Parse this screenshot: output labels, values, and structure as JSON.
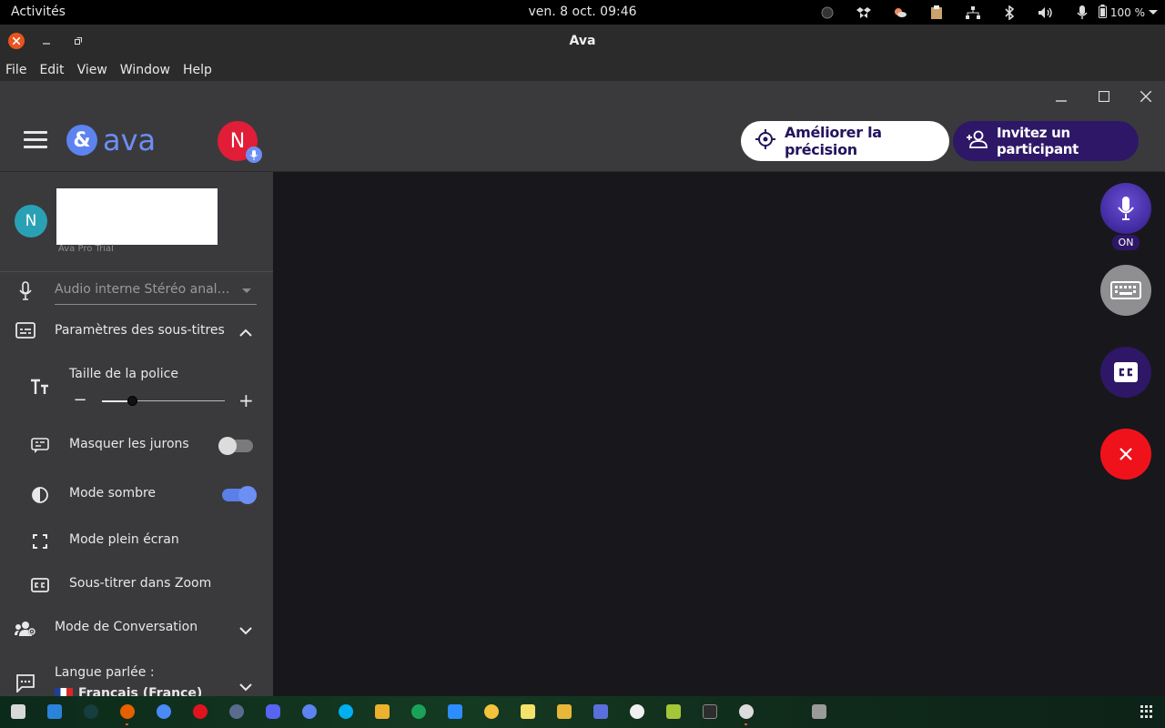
{
  "topbar": {
    "activities": "Activités",
    "clock": "ven. 8 oct.  09:46",
    "battery": "100 %",
    "tray_icons": [
      "status-dot-icon",
      "dropbox-icon",
      "weather-icon",
      "clipboard-icon",
      "network-icon",
      "bluetooth-icon",
      "volume-icon",
      "microphone-icon",
      "battery-icon"
    ]
  },
  "window": {
    "title": "Ava"
  },
  "menu": {
    "items": [
      "File",
      "Edit",
      "View",
      "Window",
      "Help"
    ]
  },
  "header": {
    "logo_symbol": "&",
    "logo_word": "ava",
    "avatar_initial": "N",
    "precision_button": "Améliorer la précision",
    "invite_button": "Invitez un participant"
  },
  "sidebar": {
    "user_initial": "N",
    "user_plan": "Ava Pro Trial",
    "audio_device": "Audio interne Stéréo analogique",
    "caption_settings": "Paramètres des sous-titres",
    "font_size": "Taille de la police",
    "font_size_level": 0.25,
    "hide_swears": "Masquer les jurons",
    "hide_swears_on": false,
    "dark_mode": "Mode sombre",
    "dark_mode_on": true,
    "fullscreen": "Mode plein écran",
    "zoom_caption": "Sous-titrer dans Zoom",
    "conversation_mode": "Mode de Conversation",
    "spoken_language_label": "Langue parlée :",
    "spoken_language_value": "Français (France)"
  },
  "controls": {
    "mic_state": "ON"
  },
  "colors": {
    "accent": "#6d8ef3",
    "brand_purple": "#2e1767",
    "danger": "#f0121b",
    "avatar_red": "#e11d38",
    "avatar_teal": "#2aa0b5"
  },
  "dock": {
    "apps": [
      "files-icon",
      "vscode-icon",
      "gitkraken-icon",
      "firefox-icon",
      "chromium-icon",
      "opera-icon",
      "browser-icon",
      "discord-icon",
      "ava-icon",
      "skype-icon",
      "slack-icon",
      "yakyak-icon",
      "zoom-icon",
      "sun-icon",
      "notes-icon",
      "archive-icon",
      "screenshot-icon",
      "emoji-icon",
      "android-icon",
      "terminal-icon",
      "obs-icon",
      "disk-icon"
    ]
  }
}
